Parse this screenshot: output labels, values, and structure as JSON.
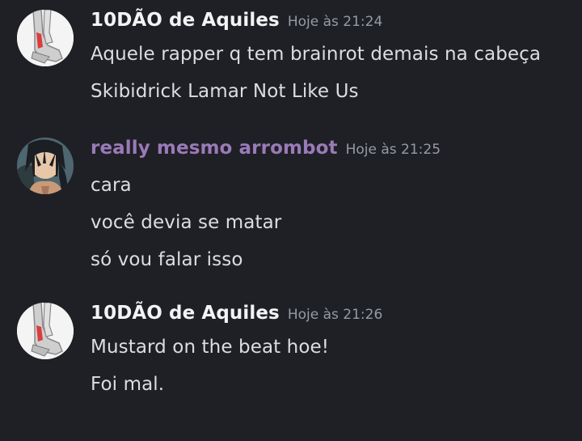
{
  "messages": [
    {
      "author": "10DÃO de Aquiles",
      "timestamp": "Hoje às 21:24",
      "avatar_icon": "ankle-xray-avatar-icon",
      "lines": [
        "Aquele rapper q tem brainrot demais na cabeça",
        "Skibidrick Lamar Not Like Us"
      ]
    },
    {
      "author": "really mesmo arrombot",
      "timestamp": "Hoje às 21:25",
      "author_color": "#9a7ab8",
      "avatar_icon": "anime-character-avatar-icon",
      "lines": [
        "cara",
        "você devia se matar",
        "só vou falar isso"
      ]
    },
    {
      "author": "10DÃO de Aquiles",
      "timestamp": "Hoje às 21:26",
      "avatar_icon": "ankle-xray-avatar-icon",
      "lines": [
        "Mustard on the beat hoe!",
        "Foi mal."
      ]
    }
  ]
}
